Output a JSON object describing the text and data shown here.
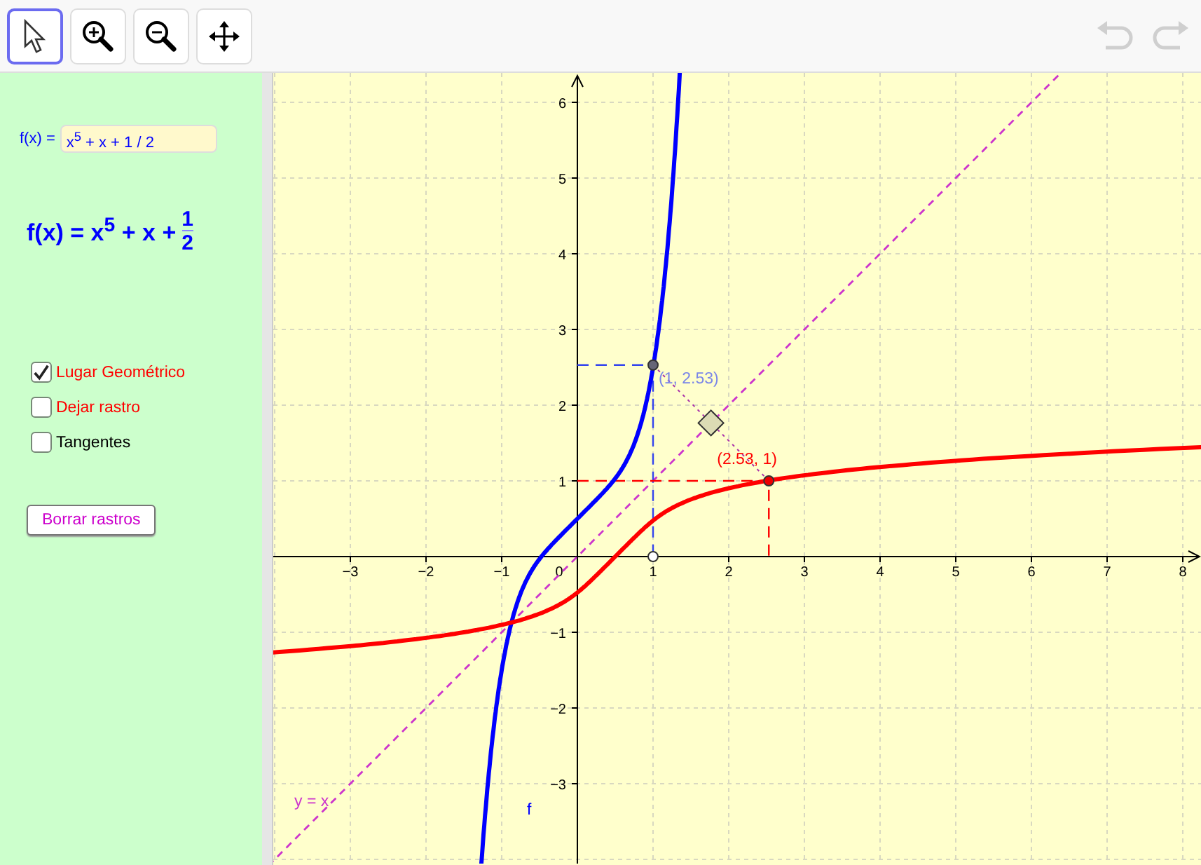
{
  "toolbar": {
    "tools": [
      {
        "kind": "pointer",
        "selected": true
      },
      {
        "kind": "zoom-in",
        "selected": false
      },
      {
        "kind": "zoom-out",
        "selected": false
      },
      {
        "kind": "move",
        "selected": false
      }
    ],
    "undo": {
      "disabled": true
    },
    "redo": {
      "disabled": true
    }
  },
  "algebra": {
    "input_label": "f(x) =",
    "input_value": "x$^{5}$ + x + 1 / 2",
    "formula": {
      "lhs": "f(x) = x$^{5}$ + x +",
      "numerator": "1",
      "denominator": "2"
    },
    "checkboxes": [
      {
        "label": "Lugar Geométrico",
        "checked": true,
        "color": "#ff0000"
      },
      {
        "label": "Dejar rastro",
        "checked": false,
        "color": "#ff0000"
      },
      {
        "label": "Tangentes",
        "checked": false,
        "color": "#000000"
      }
    ],
    "button": "Borrar rastros"
  },
  "graph": {
    "x_ticks": [
      "−3",
      "−2",
      "−1",
      "1",
      "2",
      "3",
      "4",
      "5",
      "6",
      "7",
      "8"
    ],
    "y_ticks": [
      "6",
      "5",
      "4",
      "3",
      "2",
      "1",
      "−1",
      "−2",
      "−3"
    ],
    "origin_label": "0",
    "point_labels": [
      {
        "text": "(1, 2.53)",
        "color": "#7a86e8"
      },
      {
        "text": "(2.53, 1)",
        "color": "#ff0000"
      }
    ],
    "line_label": "y = x",
    "curve_label": "f"
  }
}
